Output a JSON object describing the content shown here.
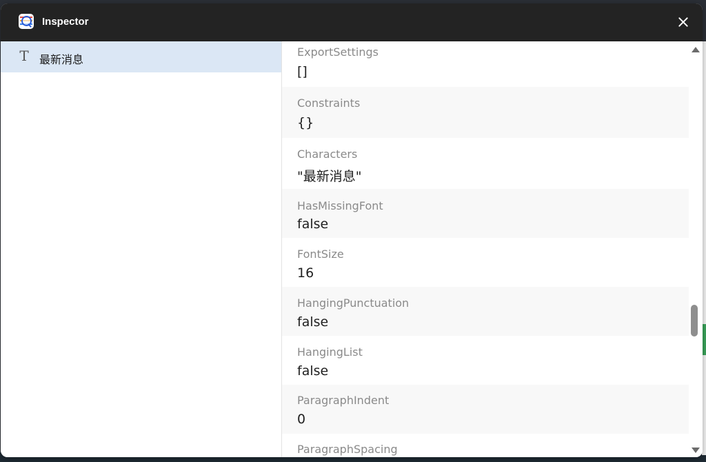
{
  "window": {
    "title": "Inspector",
    "app_icon": "inspector-magnifier-icon",
    "close_icon": "close-icon"
  },
  "tree": {
    "selected_item": {
      "icon": "text-type-icon",
      "label": "最新消息"
    }
  },
  "properties": [
    {
      "name": "ExportSettings",
      "value": "[]"
    },
    {
      "name": "Constraints",
      "value": "{}"
    },
    {
      "name": "Characters",
      "value": "\"最新消息\""
    },
    {
      "name": "HasMissingFont",
      "value": "false"
    },
    {
      "name": "FontSize",
      "value": "16"
    },
    {
      "name": "HangingPunctuation",
      "value": "false"
    },
    {
      "name": "HangingList",
      "value": "false"
    },
    {
      "name": "ParagraphIndent",
      "value": "0"
    },
    {
      "name": "ParagraphSpacing",
      "value": ""
    }
  ],
  "colors": {
    "titlebar": "#232323",
    "selected_row": "#dbe7f5",
    "alt_row": "#f8f8f8"
  }
}
